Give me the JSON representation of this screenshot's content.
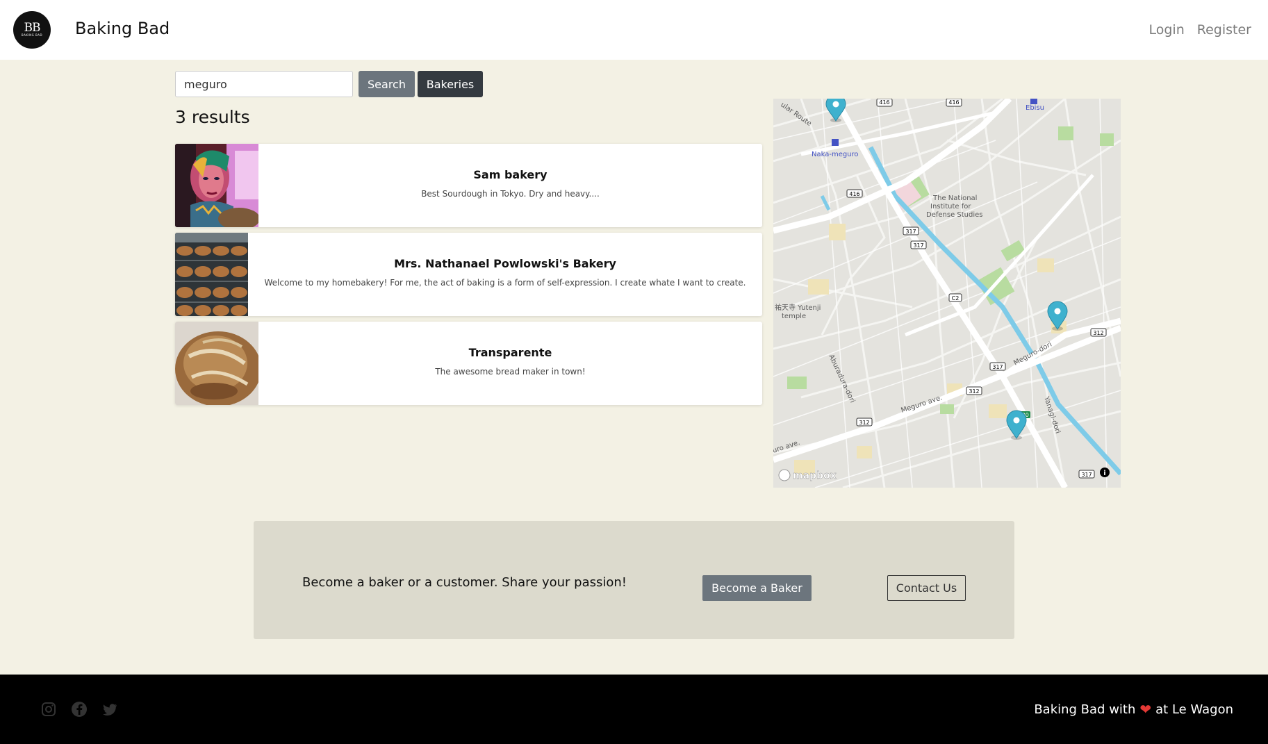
{
  "navbar": {
    "logo_mark": "BB",
    "logo_sub": "BAKING BAD",
    "brand": "Baking Bad",
    "login": "Login",
    "register": "Register"
  },
  "search": {
    "value": "meguro",
    "search_label": "Search",
    "bakeries_label": "Bakeries"
  },
  "results": {
    "count_text": "3 results",
    "items": [
      {
        "title": "Sam bakery",
        "description": "Best Sourdough in Tokyo. Dry and heavy...."
      },
      {
        "title": "Mrs. Nathanael Powlowski's Bakery",
        "description": "Welcome to my homebakery! For me, the act of baking is a form of self-expression. I create whate I want to create."
      },
      {
        "title": "Transparente",
        "description": "The awesome bread maker in town!"
      }
    ]
  },
  "map": {
    "labels": {
      "ebisu": "Ebisu",
      "naka_meguro": "Naka-meguro",
      "nids_1": "The National",
      "nids_2": "Institute for",
      "nids_3": "Defense Studies",
      "yutenji_1": "祐天寺 Yutenji",
      "yutenji_2": "temple",
      "aburadura": "Aburadura-dori",
      "meguro_ave": "Meguro ave.",
      "meguro_ave_2": "uro ave.",
      "meguro_dori": "Meguro-dori",
      "yanagi": "Yanagi-dori",
      "route": "ular Route"
    },
    "route_shields": [
      "416",
      "416",
      "416",
      "317",
      "317",
      "C2",
      "317",
      "312",
      "312",
      "312",
      "317",
      "C20"
    ],
    "attribution": "mapbox",
    "info_icon": "info-icon"
  },
  "cta": {
    "text": "Become a baker or a customer. Share your passion!",
    "baker_button": "Become a Baker",
    "contact_button": "Contact Us"
  },
  "footer": {
    "icons": [
      "instagram-icon",
      "facebook-icon",
      "twitter-icon"
    ],
    "credit_prefix": "Baking Bad with",
    "credit_suffix": "at Le Wagon",
    "heart": "❤"
  },
  "colors": {
    "page_bg": "#f3f1e4",
    "search_btn": "#6c757d",
    "bakeries_btn": "#343a40",
    "cta_bg": "#dcdacd",
    "map_marker": "#3fb1ce",
    "heart": "#e53935"
  }
}
